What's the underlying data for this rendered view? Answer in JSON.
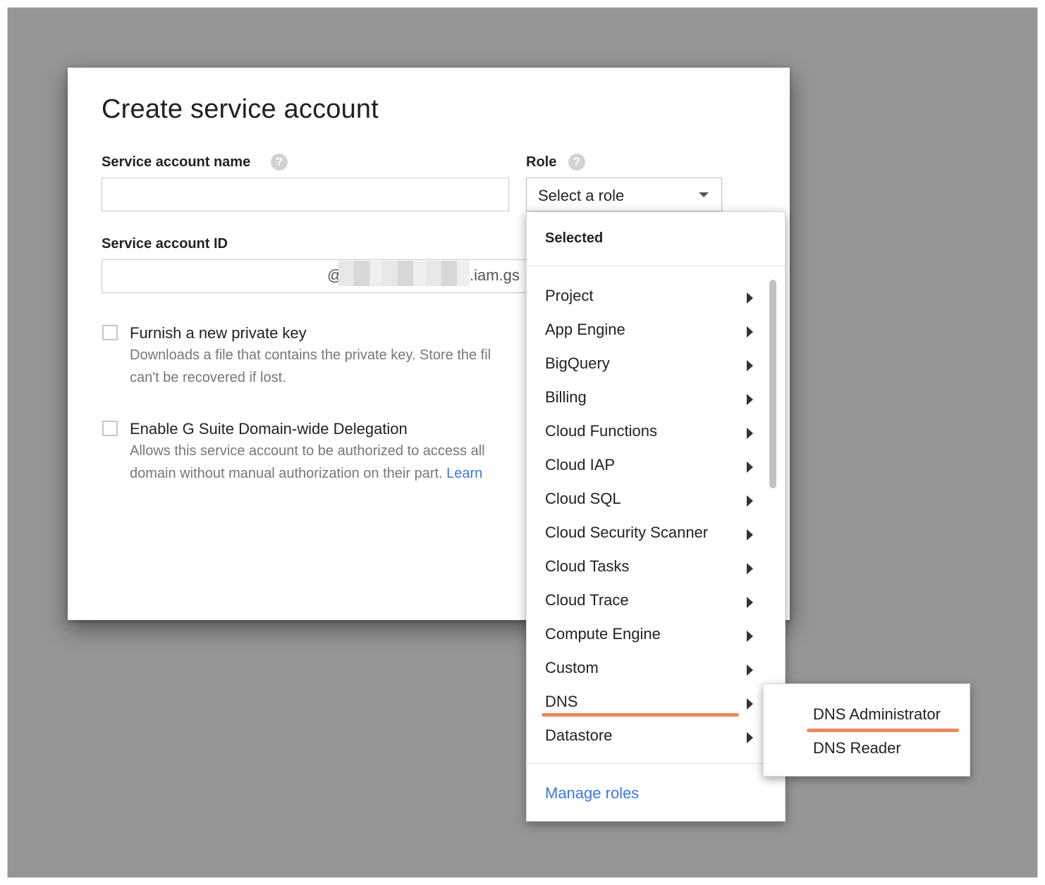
{
  "dialog": {
    "title": "Create service account",
    "name_label": "Service account name",
    "name_value": "",
    "role_label": "Role",
    "role_placeholder": "Select a role",
    "id_label": "Service account ID",
    "id_suffix": "@",
    "id_domain": ".iam.gs",
    "help_glyph": "?",
    "private_key": {
      "label": "Furnish a new private key",
      "desc_line1": "Downloads a file that contains the private key. Store the fil",
      "desc_line2": "can't be recovered if lost."
    },
    "delegation": {
      "label": "Enable G Suite Domain-wide Delegation",
      "desc_line1": "Allows this service account to be authorized to access all",
      "desc_line2": "domain without manual authorization on their part.",
      "link": "Learn"
    }
  },
  "role_menu": {
    "header": "Selected",
    "items": [
      {
        "label": "Project"
      },
      {
        "label": "App Engine"
      },
      {
        "label": "BigQuery"
      },
      {
        "label": "Billing"
      },
      {
        "label": "Cloud Functions"
      },
      {
        "label": "Cloud IAP"
      },
      {
        "label": "Cloud SQL"
      },
      {
        "label": "Cloud Security Scanner"
      },
      {
        "label": "Cloud Tasks"
      },
      {
        "label": "Cloud Trace"
      },
      {
        "label": "Compute Engine"
      },
      {
        "label": "Custom"
      },
      {
        "label": "DNS"
      },
      {
        "label": "Datastore"
      }
    ],
    "manage_roles": "Manage roles"
  },
  "dns_submenu": {
    "items": [
      {
        "label": "DNS Administrator"
      },
      {
        "label": "DNS Reader"
      }
    ]
  },
  "colors": {
    "backdrop": "#959595",
    "link": "#3b78e7",
    "highlight_underline": "#f0875b"
  }
}
